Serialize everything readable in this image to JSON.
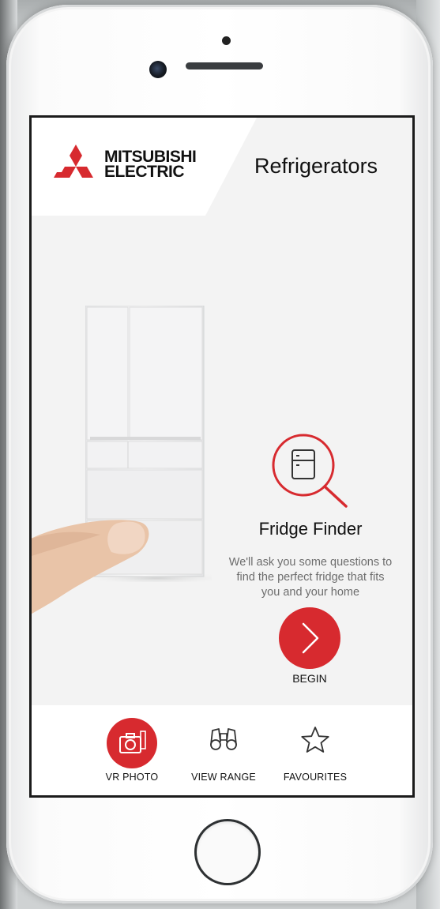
{
  "brand": {
    "logo_line1": "MITSUBISHI",
    "logo_line2": "ELECTRIC",
    "logo_color": "#d72a2f"
  },
  "header": {
    "title": "Refrigerators"
  },
  "finder": {
    "icon": "fridge-search-icon",
    "title": "Fridge Finder",
    "description": "We'll ask you some questions to find the perfect fridge that fits you and your home",
    "begin_label": "BEGIN",
    "accent": "#d72a2f"
  },
  "tabbar": {
    "tabs": [
      {
        "label": "VR PHOTO",
        "icon": "camera-icon",
        "active": true
      },
      {
        "label": "VIEW RANGE",
        "icon": "binoculars-icon",
        "active": false
      },
      {
        "label": "FAVOURITES",
        "icon": "star-icon",
        "active": false
      }
    ]
  }
}
